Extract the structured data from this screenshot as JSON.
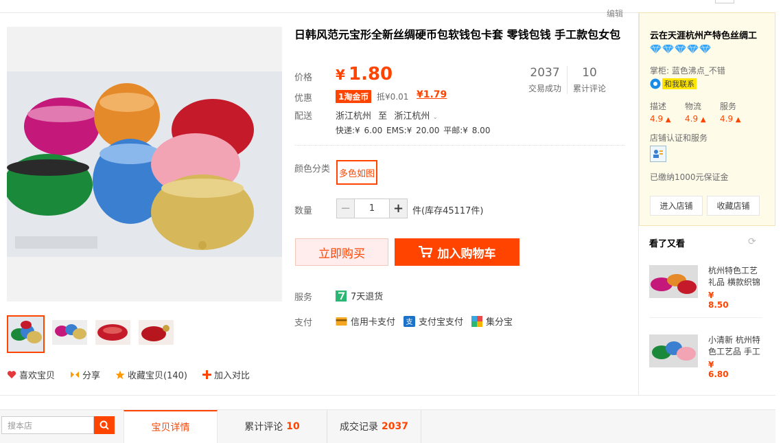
{
  "product": {
    "title": "日韩风范元宝形全新丝绸硬币包软钱包卡套 零钱包钱 手工款包女包",
    "edit_label": "编辑",
    "price_label": "价格",
    "currency": "¥",
    "price": "1.80",
    "promo_label": "优惠",
    "coin_badge": "1淘金币",
    "deduct_text": "抵¥0.01",
    "coin_price": "¥1.79",
    "delivery_label": "配送",
    "ship_from": "浙江杭州",
    "ship_to_word": "至",
    "ship_to": "浙江杭州",
    "ship_fees": "快递:¥ 6.00   EMS:¥ 20.00   平邮:¥ 8.00",
    "sales_count": "2037",
    "sales_label": "交易成功",
    "review_count": "10",
    "review_label": "累计评论",
    "color_label": "颜色分类",
    "color_option": "多色如图",
    "qty_label": "数量",
    "qty_value": "1",
    "qty_minus": "−",
    "qty_plus": "+",
    "stock_text": "件(库存45117件)",
    "buy_now": "立即购买",
    "add_cart": "加入购物车",
    "service_label": "服务",
    "service_text": "7天退货",
    "pay_label": "支付",
    "pay_methods": [
      "信用卡支付",
      "支付宝支付",
      "集分宝"
    ]
  },
  "gallery_actions": [
    {
      "label": "喜欢宝贝",
      "icon": "heart-icon",
      "color": "#e4393c"
    },
    {
      "label": "分享",
      "icon": "share-icon",
      "color": "#f90"
    },
    {
      "label": "收藏宝贝(140)",
      "icon": "star-icon",
      "color": "#f90"
    },
    {
      "label": "加入对比",
      "icon": "plus-icon",
      "color": "#f40"
    }
  ],
  "shop": {
    "name": "云在天涯杭州产特色丝绸工",
    "diamond_count": 5,
    "owner": "掌柜: 蓝色沸点_不错",
    "contact": "和我联系",
    "scores": [
      {
        "label": "描述",
        "value": "4.9"
      },
      {
        "label": "物流",
        "value": "4.9"
      },
      {
        "label": "服务",
        "value": "4.9"
      }
    ],
    "cert_label": "店铺认证和服务",
    "deposit": "已缴纳1000元保证金",
    "enter_btn": "进入店铺",
    "fav_btn": "收藏店铺"
  },
  "recommend": {
    "title": "看了又看",
    "items": [
      {
        "text": "杭州特色工艺礼品 横款织锦",
        "price": "¥ 8.50"
      },
      {
        "text": "小清新 杭州特色工艺品 手工",
        "price": "¥ 6.80"
      }
    ]
  },
  "tabs": {
    "search_placeholder": "搜本店",
    "items": [
      {
        "label": "宝贝详情",
        "count": ""
      },
      {
        "label": "累计评论",
        "count": "10"
      },
      {
        "label": "成交记录",
        "count": "2037"
      }
    ]
  },
  "colors": {
    "accent": "#ff4400",
    "diamond": "#3aa5f5"
  }
}
